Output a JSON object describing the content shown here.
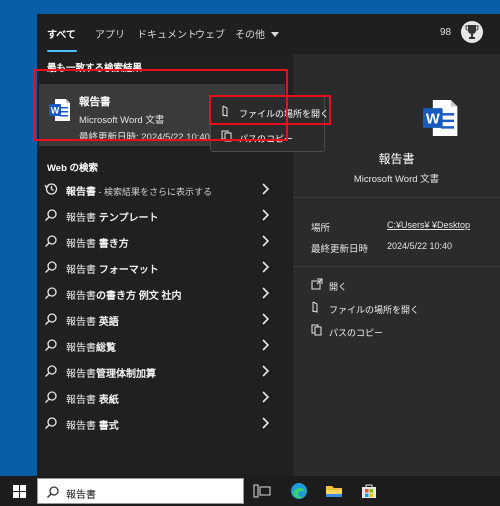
{
  "tabs": [
    {
      "label": "すべて",
      "active": true
    },
    {
      "label": "アプリ"
    },
    {
      "label": "ドキュメント"
    },
    {
      "label": "ウェブ"
    },
    {
      "label": "その他"
    }
  ],
  "points": "98",
  "best_match": {
    "section_label": "最も一致する検索結果",
    "title": "報告書",
    "type": "Microsoft Word 文書",
    "modified": "最終更新日時: 2024/5/22 10:40"
  },
  "context_menu": {
    "open_location": "ファイルの場所を開く",
    "copy_path": "パスのコピー"
  },
  "web": {
    "section_label": "Web の検索",
    "rows": [
      {
        "bold": "報告書",
        "rest": " - 検索結果をさらに表示する",
        "icon": "history-icon"
      },
      {
        "bold": "報告書",
        "rest": " テンプレート",
        "icon": "search-icon"
      },
      {
        "bold": "報告書",
        "rest": " 書き方",
        "icon": "search-icon"
      },
      {
        "bold": "報告書",
        "rest": " フォーマット",
        "icon": "search-icon"
      },
      {
        "bold": "報告書",
        "rest": "の書き方 例文 社内",
        "icon": "search-icon"
      },
      {
        "bold": "報告書",
        "rest": " 英語",
        "icon": "search-icon"
      },
      {
        "bold": "報告書",
        "rest": "総覧",
        "icon": "search-icon"
      },
      {
        "bold": "報告書",
        "rest": "管理体制加算",
        "icon": "search-icon"
      },
      {
        "bold": "報告書",
        "rest": " 表紙",
        "icon": "search-icon"
      },
      {
        "bold": "報告書",
        "rest": " 書式",
        "icon": "search-icon"
      }
    ]
  },
  "preview": {
    "title": "報告書",
    "type": "Microsoft Word 文書",
    "location_label": "場所",
    "location_value": "C:¥Users¥          ¥Desktop",
    "modified_label": "最終更新日時",
    "modified_value": "2024/5/22 10:40",
    "actions": [
      {
        "label": "開く",
        "icon": "open-icon"
      },
      {
        "label": "ファイルの場所を開く",
        "icon": "folder-location-icon"
      },
      {
        "label": "パスのコピー",
        "icon": "copy-icon"
      }
    ]
  },
  "taskbar": {
    "search_text": "報告書"
  },
  "colors": {
    "highlight_border": "#e8101a",
    "accent": "#4cc2ff",
    "desktop": "#0a5ea8",
    "word_blue": "#185abd"
  }
}
